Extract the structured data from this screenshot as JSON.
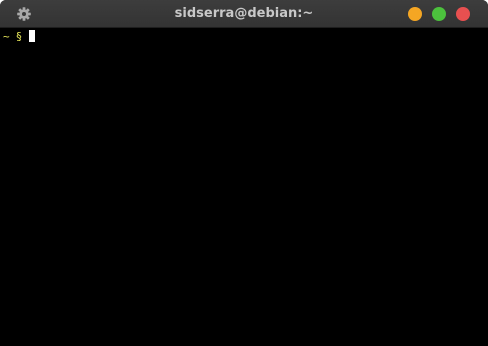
{
  "window": {
    "title": "sidserra@debian:~",
    "settings_icon": "gear-icon",
    "buttons": {
      "minimize_color": "#f5a623",
      "maximize_color": "#4cc13d",
      "close_color": "#e85050"
    }
  },
  "terminal": {
    "prompt_dir": "~",
    "prompt_symbol": "§",
    "input": ""
  }
}
